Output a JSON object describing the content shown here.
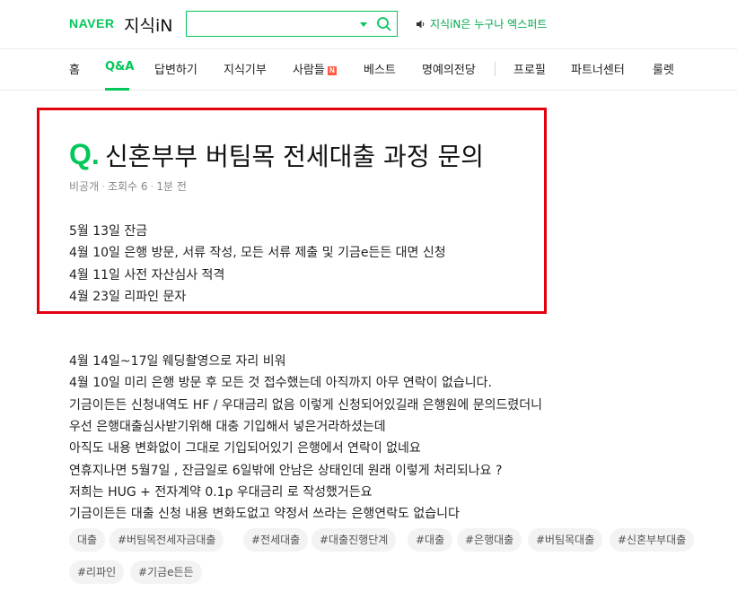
{
  "header": {
    "logo_naver": "NAVER",
    "logo_service": "지식iN",
    "search": {
      "value": "",
      "placeholder": ""
    },
    "notice": "지식iN은 누구나 엑스퍼트"
  },
  "nav": {
    "items": [
      {
        "label": "홈"
      },
      {
        "label": "Q&A"
      },
      {
        "label": "답변하기"
      },
      {
        "label": "지식기부"
      },
      {
        "label": "사람들",
        "badge": "N"
      },
      {
        "label": "베스트"
      },
      {
        "label": "명예의전당"
      },
      {
        "label": "프로필"
      },
      {
        "label": "파트너센터"
      },
      {
        "label": "룰렛"
      }
    ]
  },
  "question": {
    "q_mark": "Q.",
    "title": "신혼부부 버팀목 전세대출 과정 문의",
    "meta": {
      "author": "비공개",
      "views": "조회수 6",
      "time": "1분 전"
    },
    "highlighted_lines": [
      "5월 13일 잔금",
      "4월 10일 은행 방문, 서류 작성, 모든 서류 제출 및 기금e든든 대면 신청",
      "4월 11일 사전 자산심사 적격",
      "4월 23일 리파인 문자"
    ],
    "body_lines": [
      "4월 14일~17일 웨딩촬영으로 자리 비워",
      "4월 10일 미리 은행 방문 후 모든 것 접수했는데 아직까지 아무 연락이 없습니다.",
      "기금이든든 신청내역도 HF / 우대금리 없음 이렇게 신청되어있길래 은행원에 문의드렸더니",
      "우선 은행대출심사받기위해 대충 기입해서 넣은거라하셨는데",
      "아직도 내용 변화없이 그대로 기입되어있기 은행에서 연락이 없네요",
      "연휴지나면 5월7일 , 잔금일로 6일밖에 안남은 상태인데 원래 이렇게 처리되나요 ?",
      "저희는 HUG + 전자계약 0.1p 우대금리 로 작성했거든요",
      "기금이든든 대출 신청 내용 변화도없고 약정서 쓰라는 은행연락도 없습니다"
    ],
    "tags": [
      "대출",
      "#버팀목전세자금대출",
      "#전세대출",
      "#대출진행단계",
      "#대출",
      "#은행대출",
      "#버팀목대출",
      "#신혼부부대출",
      "#리파인",
      "#기금e든든"
    ]
  },
  "colors": {
    "brand_green": "#03c75a",
    "highlight_red": "#e3000f",
    "new_badge": "#ff5b44"
  }
}
